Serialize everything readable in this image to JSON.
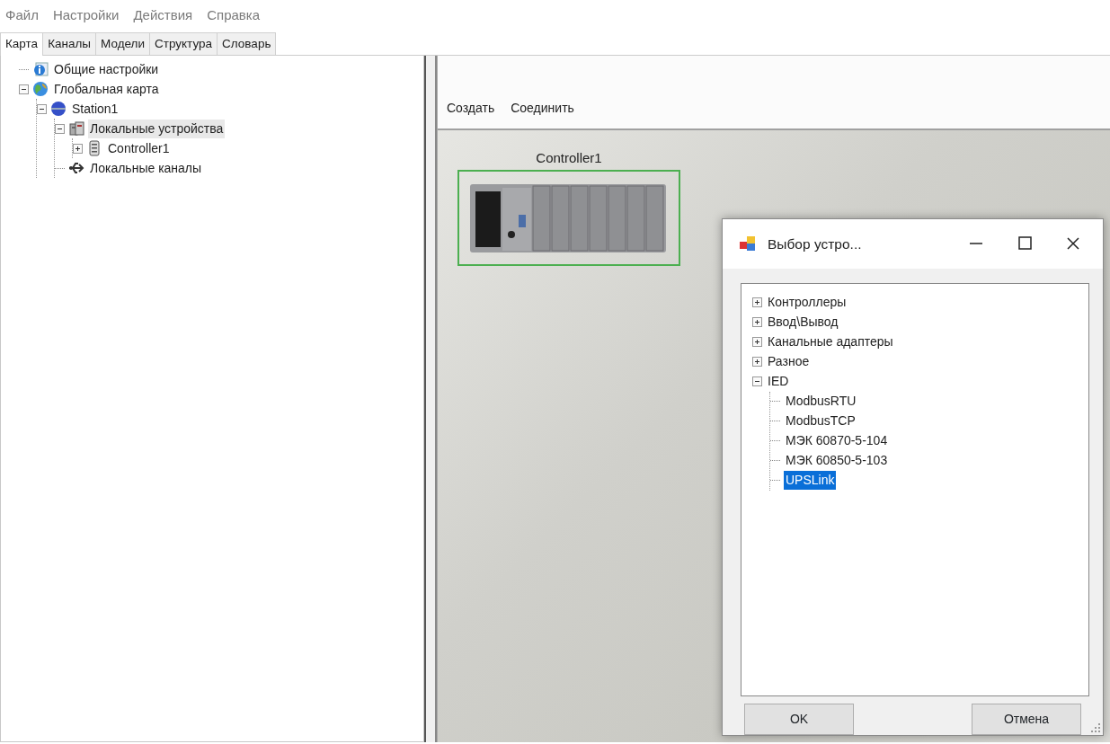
{
  "menu": [
    "Файл",
    "Настройки",
    "Действия",
    "Справка"
  ],
  "tabs": [
    {
      "label": "Карта",
      "selected": true
    },
    {
      "label": "Каналы",
      "selected": false
    },
    {
      "label": "Модели",
      "selected": false
    },
    {
      "label": "Структура",
      "selected": false
    },
    {
      "label": "Словарь",
      "selected": false
    }
  ],
  "tree": [
    {
      "label": "Общие настройки",
      "kind": "info",
      "selected": false
    },
    {
      "label": "Глобальная карта",
      "kind": "globe",
      "selected": false,
      "expanded": true,
      "children": [
        {
          "label": "Station1",
          "kind": "station",
          "selected": false,
          "expanded": true,
          "children": [
            {
              "label": "Локальные устройства",
              "kind": "devices",
              "selected": true,
              "expanded": true,
              "children": [
                {
                  "label": "Controller1",
                  "kind": "controller",
                  "selected": false,
                  "expanded": false
                }
              ]
            },
            {
              "label": "Локальные каналы",
              "kind": "usb",
              "selected": false
            }
          ]
        }
      ]
    }
  ],
  "toolbar": [
    "Создать",
    "Соединить"
  ],
  "canvas": {
    "nodes": [
      {
        "label": "Controller1",
        "selected": true
      }
    ]
  },
  "dialog": {
    "title": "Выбор устро...",
    "tree": [
      {
        "label": "Контроллеры",
        "expanded": false,
        "selected": false
      },
      {
        "label": "Ввод\\Вывод",
        "expanded": false,
        "selected": false
      },
      {
        "label": "Канальные адаптеры",
        "expanded": false,
        "selected": false
      },
      {
        "label": "Разное",
        "expanded": false,
        "selected": false
      },
      {
        "label": "IED",
        "expanded": true,
        "selected": false,
        "children": [
          {
            "label": "ModbusRTU",
            "selected": false
          },
          {
            "label": "ModbusTCP",
            "selected": false
          },
          {
            "label": "МЭК 60870-5-104",
            "selected": false
          },
          {
            "label": "МЭК 60850-5-103",
            "selected": false
          },
          {
            "label": "UPSLink",
            "selected": true
          }
        ]
      }
    ],
    "buttons": [
      "OK",
      "Отмена"
    ]
  }
}
